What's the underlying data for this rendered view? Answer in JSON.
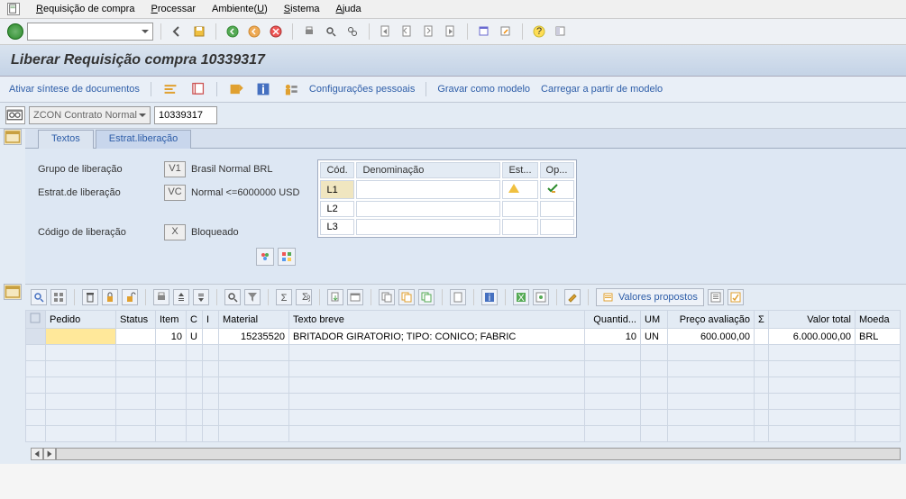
{
  "menu": {
    "items": [
      "Requisição de compra",
      "Processar",
      "Ambiente(U)",
      "Sistema",
      "Ajuda"
    ]
  },
  "title": "Liberar Requisição compra 10339317",
  "app_toolbar": {
    "activate_doc_view": "Ativar síntese de documentos",
    "personal_settings": "Configurações pessoais",
    "save_template": "Gravar como modelo",
    "load_template": "Carregar a partir de modelo"
  },
  "header": {
    "doctype": "ZCON Contrato Normal",
    "docnum": "10339317"
  },
  "tabs": [
    "Textos",
    "Estrat.liberação"
  ],
  "release": {
    "group_label": "Grupo de liberação",
    "group_code": "V1",
    "group_desc": "Brasil Normal BRL",
    "strategy_label": "Estrat.de liberação",
    "strategy_code": "VC",
    "strategy_desc": "Normal <=6000000 USD",
    "indicator_label": "Código de liberação",
    "indicator_code": "X",
    "indicator_desc": "Bloqueado",
    "table": {
      "headers": [
        "Cód.",
        "Denominação",
        "Est...",
        "Op..."
      ],
      "rows": [
        {
          "code": "L1",
          "name": "",
          "status": "warn",
          "op": "check"
        },
        {
          "code": "L2",
          "name": "",
          "status": "",
          "op": ""
        },
        {
          "code": "L3",
          "name": "",
          "status": "",
          "op": ""
        }
      ]
    }
  },
  "items_toolbar": {
    "valores_propostos": "Valores propostos"
  },
  "items_grid": {
    "headers": [
      "",
      "Pedido",
      "Status",
      "Item",
      "C",
      "I",
      "Material",
      "Texto breve",
      "Quantid...",
      "UM",
      "Preço avaliação",
      "Σ",
      "Valor total",
      "Moeda"
    ],
    "rows": [
      {
        "pedido": "",
        "status": "",
        "item": "10",
        "c": "U",
        "i": "",
        "material": "15235520",
        "texto": "BRITADOR GIRATORIO; TIPO: CONICO; FABRIC",
        "quant": "10",
        "um": "UN",
        "preco": "600.000,00",
        "sigma": "",
        "total": "6.000.000,00",
        "moeda": "BRL"
      }
    ]
  }
}
